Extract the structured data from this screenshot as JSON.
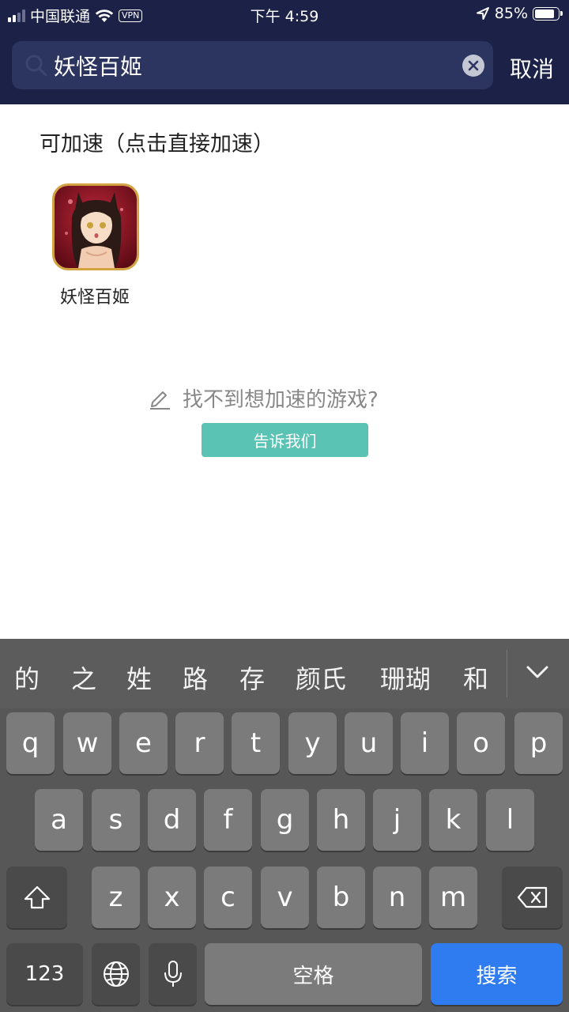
{
  "status_bar": {
    "carrier": "中国联通",
    "vpn": "VPN",
    "time": "下午 4:59",
    "battery_percent": "85%",
    "battery_level": 0.85
  },
  "search": {
    "query": "妖怪百姬",
    "cancel_label": "取消",
    "icon": "search-icon"
  },
  "results": {
    "section_title": "可加速（点击直接加速）",
    "games": [
      {
        "name": "妖怪百姬"
      }
    ]
  },
  "not_found": {
    "text": "找不到想加速的游戏?",
    "button_label": "告诉我们"
  },
  "keyboard": {
    "candidates": [
      "的",
      "之",
      "姓",
      "路",
      "存",
      "颜氏",
      "珊瑚",
      "和"
    ],
    "row1": [
      "q",
      "w",
      "e",
      "r",
      "t",
      "y",
      "u",
      "i",
      "o",
      "p"
    ],
    "row2": [
      "a",
      "s",
      "d",
      "f",
      "g",
      "h",
      "j",
      "k",
      "l"
    ],
    "row3": [
      "z",
      "x",
      "c",
      "v",
      "b",
      "n",
      "m"
    ],
    "num_label": "123",
    "space_label": "空格",
    "search_label": "搜索"
  },
  "colors": {
    "header_bg": "#1b2147",
    "accent_button": "#5bc3b3",
    "keyboard_search": "#2f7bf0"
  }
}
